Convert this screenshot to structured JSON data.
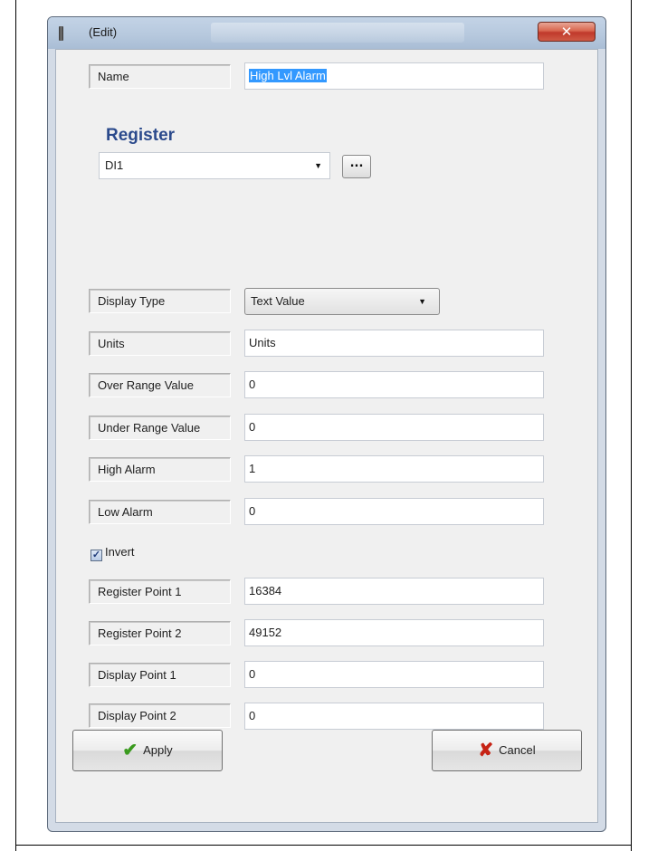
{
  "window": {
    "title": "(Edit)",
    "close_glyph": "✕"
  },
  "fields": {
    "name": {
      "label": "Name",
      "value": "High Lvl Alarm"
    },
    "register": {
      "heading": "Register",
      "selected": "DI1",
      "browse_label": "..."
    },
    "display_type": {
      "label": "Display Type",
      "selected": "Text Value"
    },
    "units": {
      "label": "Units",
      "value": "Units"
    },
    "over_range": {
      "label": "Over Range Value",
      "value": "0"
    },
    "under_range": {
      "label": "Under Range Value",
      "value": "0"
    },
    "high_alarm": {
      "label": "High Alarm",
      "value": "1"
    },
    "low_alarm": {
      "label": "Low Alarm",
      "value": "0"
    },
    "invert": {
      "label": "Invert",
      "checked": true
    },
    "register_point_1": {
      "label": "Register Point 1",
      "value": "16384"
    },
    "register_point_2": {
      "label": "Register Point 2",
      "value": "49152"
    },
    "display_point_1": {
      "label": "Display Point 1",
      "value": "0"
    },
    "display_point_2": {
      "label": "Display Point 2",
      "value": "0"
    }
  },
  "buttons": {
    "apply": "Apply",
    "cancel": "Cancel"
  },
  "colors": {
    "accent_heading": "#2b4a8c",
    "apply_icon": "#3a9a1e",
    "cancel_icon": "#c62315",
    "close_button": "#c0392b"
  }
}
